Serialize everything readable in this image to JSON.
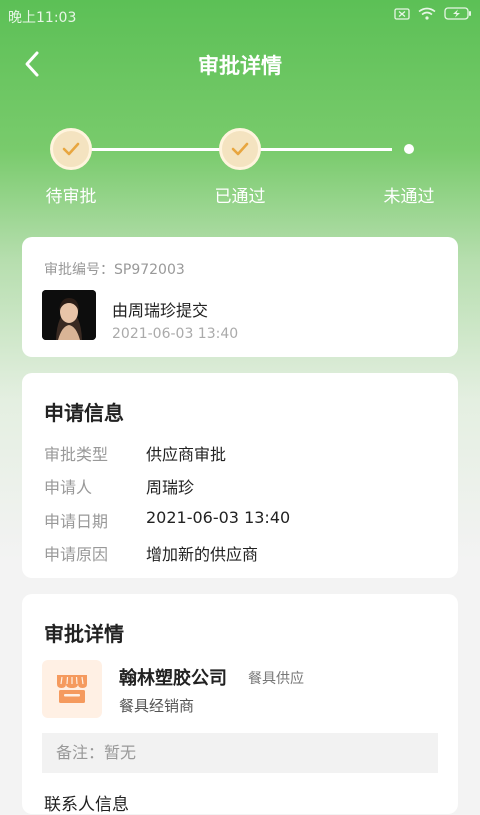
{
  "status_bar": {
    "time": "晚上11:03"
  },
  "nav": {
    "title": "审批详情"
  },
  "steps": [
    {
      "label": "待审批",
      "state": "done"
    },
    {
      "label": "已通过",
      "state": "done"
    },
    {
      "label": "未通过",
      "state": "pending"
    }
  ],
  "submission": {
    "approval_no": "审批编号：SP972003",
    "submitter_text": "由周瑞珍提交",
    "time": "2021-06-03 13:40"
  },
  "application_info": {
    "title": "申请信息",
    "rows": [
      {
        "label": "审批类型",
        "value": "供应商审批"
      },
      {
        "label": "申请人",
        "value": "周瑞珍"
      },
      {
        "label": "申请日期",
        "value": "2021-06-03 13:40"
      },
      {
        "label": "申请原因",
        "value": "增加新的供应商"
      }
    ]
  },
  "approval_detail": {
    "title": "审批详情",
    "company_name": "翰林塑胶公司",
    "company_tag": "餐具供应",
    "company_type": "餐具经销商",
    "remark": "备注：暂无",
    "contact_title": "联系人信息"
  },
  "colors": {
    "brand_green": "#5cc056",
    "step_check": "#f4e3c0",
    "check_mark": "#e8a640",
    "shop_orange": "#f59a5e"
  }
}
